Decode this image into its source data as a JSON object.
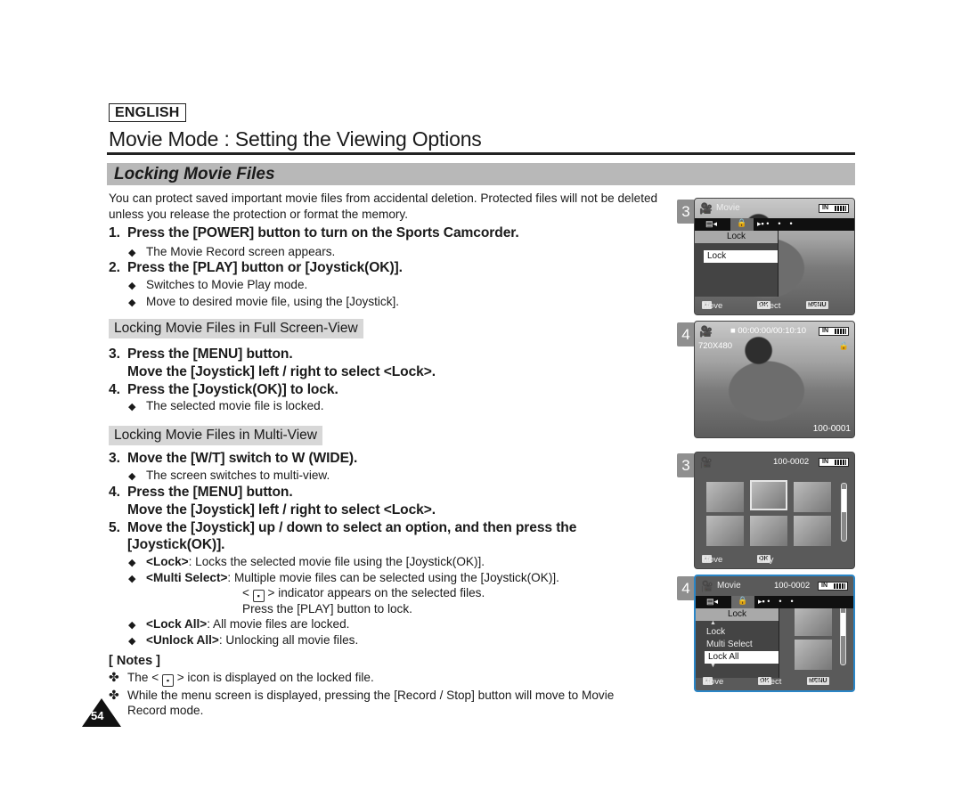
{
  "language_badge": "ENGLISH",
  "page_title": "Movie Mode : Setting the Viewing Options",
  "section_title": "Locking Movie Files",
  "intro": "You can protect saved important movie files from accidental deletion. Protected files will not be deleted unless you release the protection or format the memory.",
  "steps_common": [
    {
      "num": "1.",
      "text": "Press the [POWER] button to turn on the Sports Camcorder.",
      "bullets": [
        "The Movie Record screen appears."
      ]
    },
    {
      "num": "2.",
      "text": "Press the [PLAY] button or [Joystick(OK)].",
      "bullets": [
        "Switches to Movie Play mode.",
        "Move to desired movie file, using the [Joystick]."
      ]
    }
  ],
  "full_screen": {
    "heading": "Locking Movie Files in Full Screen-View",
    "step3_line1": "Press the [MENU] button.",
    "step3_line2": "Move the [Joystick] left / right to select <Lock>.",
    "step4": "Press the [Joystick(OK)] to lock.",
    "step4_bullet": "The selected movie file is locked."
  },
  "multi_view": {
    "heading": "Locking Movie Files in Multi-View",
    "step3": "Move the [W/T] switch to W (WIDE).",
    "step3_bullet": "The screen switches to multi-view.",
    "step4_line1": "Press the [MENU] button.",
    "step4_line2": "Move the [Joystick] left / right to select <Lock>.",
    "step5_line1": "Move the [Joystick] up / down to select an option, and then press the",
    "step5_line2": "[Joystick(OK)].",
    "options": [
      {
        "term": "<Lock>",
        "desc": ": Locks the selected movie file using the [Joystick(OK)]."
      },
      {
        "term": "<Multi Select>",
        "desc": ": Multiple movie files can be selected using the [Joystick(OK)]."
      },
      {
        "term": "<Lock All>",
        "desc": ": All movie files are locked."
      },
      {
        "term": "<Unlock All>",
        "desc": ": Unlocking all movie files."
      }
    ],
    "multi_cont1_pre": "<",
    "multi_cont1_post": "> indicator appears on the selected files.",
    "multi_cont2": "Press the [PLAY] button to lock."
  },
  "step_nums": {
    "s1": "1.",
    "s2": "2.",
    "s3": "3.",
    "s4": "4.",
    "s5": "5."
  },
  "notes": {
    "heading": "[ Notes ]",
    "note1_pre": "The <",
    "note1_post": "> icon is displayed on the locked file.",
    "note2_line1": "While the menu screen is displayed, pressing the [Record / Stop] button will move to Movie",
    "note2_line2": "Record mode."
  },
  "page_number": "54",
  "screens": [
    {
      "step": "3",
      "mode": "Movie",
      "menu_title": "Lock",
      "items": [
        "Lock"
      ],
      "bottom": {
        "move": "Move",
        "select": "Select",
        "exit": "Exit"
      },
      "keys": {
        "ok": "OK",
        "menu": "MENU"
      }
    },
    {
      "step": "4",
      "timecode": "00:00:00/00:10:10",
      "resolution": "720X480",
      "file": "100-0001"
    },
    {
      "step": "3",
      "file": "100-0002",
      "bottom": {
        "move": "Move",
        "play": "Play"
      },
      "keys": {
        "ok": "OK"
      }
    },
    {
      "step": "4",
      "mode": "Movie",
      "file": "100-0002",
      "menu_title": "Lock",
      "items": [
        "Lock",
        "Multi Select",
        "Lock All"
      ],
      "selected": "Lock All",
      "bottom": {
        "move": "Move",
        "select": "Select",
        "exit": "Exit"
      },
      "keys": {
        "ok": "OK",
        "menu": "MENU"
      }
    }
  ],
  "battery_label": "IN",
  "lock_symbol": "🔒"
}
